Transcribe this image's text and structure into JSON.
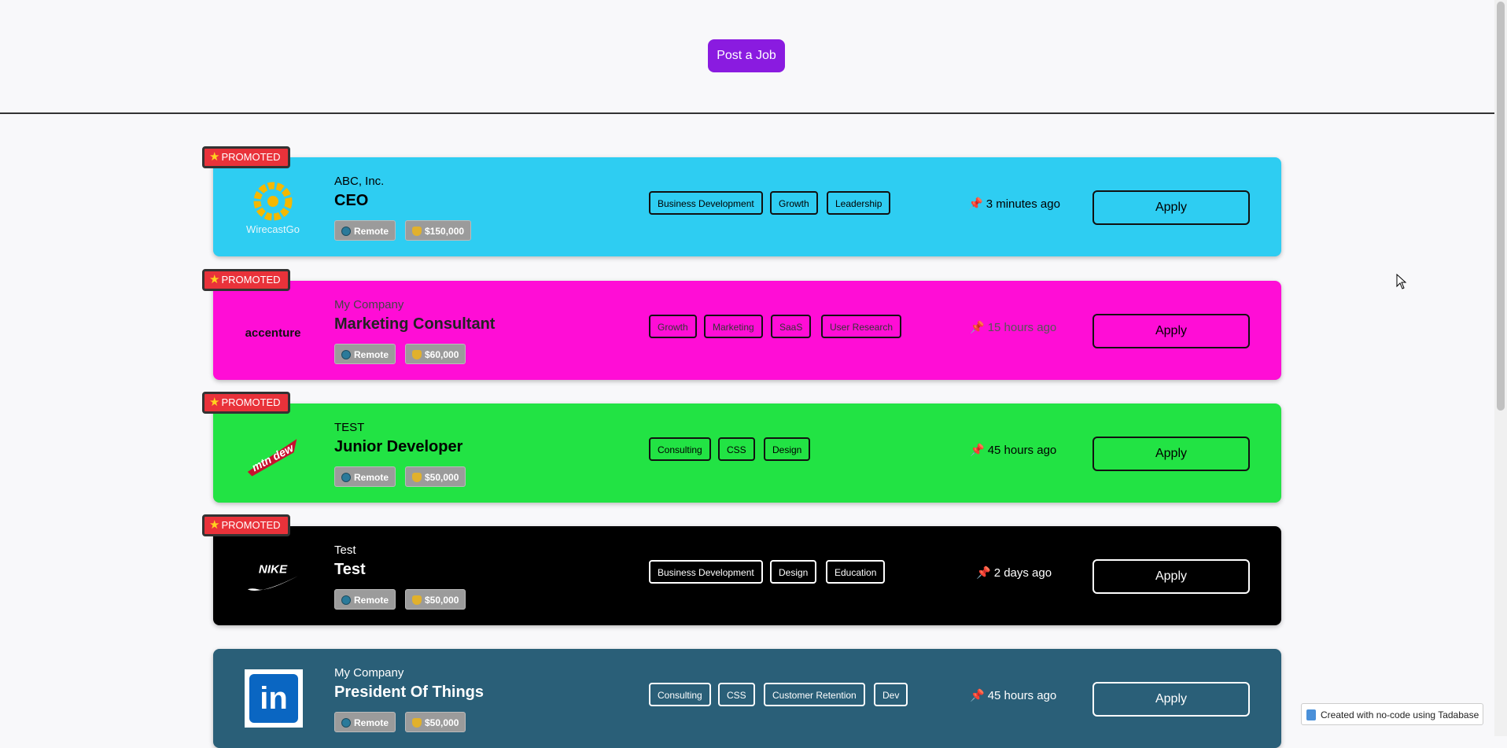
{
  "header": {
    "post_job_label": "Post a Job"
  },
  "promoted_label": "PROMOTED",
  "apply_label": "Apply",
  "jobs": [
    {
      "company": "ABC, Inc.",
      "title": "CEO",
      "logo_text": "WirecastGo",
      "location": "Remote",
      "salary": "$150,000",
      "tags": [
        "Business Development",
        "Growth",
        "Leadership"
      ],
      "posted": "3 minutes ago",
      "promoted": true,
      "color": "#2ecdf2"
    },
    {
      "company": "My Company",
      "title": "Marketing Consultant",
      "logo_text": "accenture",
      "location": "Remote",
      "salary": "$60,000",
      "tags": [
        "Growth",
        "Marketing",
        "SaaS",
        "User Research"
      ],
      "posted": "15 hours ago",
      "promoted": true,
      "color": "#ff0dd6"
    },
    {
      "company": "TEST",
      "title": "Junior Developer",
      "logo_text": "mtn dew",
      "location": "Remote",
      "salary": "$50,000",
      "tags": [
        "Consulting",
        "CSS",
        "Design"
      ],
      "posted": "45 hours ago",
      "promoted": true,
      "color": "#22e344"
    },
    {
      "company": "Test",
      "title": "Test",
      "logo_text": "NIKE",
      "location": "Remote",
      "salary": "$50,000",
      "tags": [
        "Business Development",
        "Design",
        "Education"
      ],
      "posted": "2 days ago",
      "promoted": true,
      "color": "#000000"
    },
    {
      "company": "My Company",
      "title": "President Of Things",
      "logo_text": "in",
      "location": "Remote",
      "salary": "$50,000",
      "tags": [
        "Consulting",
        "CSS",
        "Customer Retention",
        "Dev"
      ],
      "posted": "45 hours ago",
      "promoted": false,
      "color": "#2a5f78"
    }
  ],
  "footer": {
    "badge_text": "Created with no-code using Tadabase"
  }
}
